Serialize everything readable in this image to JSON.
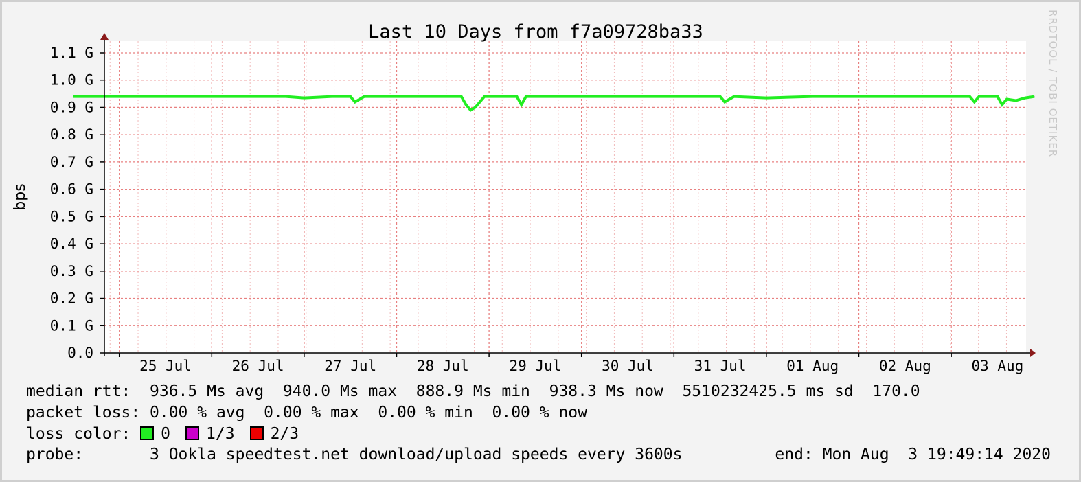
{
  "chart_data": {
    "type": "line",
    "title": "Last 10 Days from f7a09728ba33",
    "ylabel": "bps",
    "xlabel": "",
    "ylim": [
      0,
      1.1
    ],
    "y_unit": "G",
    "yticks": [
      "0.0",
      "0.1 G",
      "0.2 G",
      "0.3 G",
      "0.4 G",
      "0.5 G",
      "0.6 G",
      "0.7 G",
      "0.8 G",
      "0.9 G",
      "1.0 G",
      "1.1 G"
    ],
    "xticks": [
      "25 Jul",
      "26 Jul",
      "27 Jul",
      "28 Jul",
      "29 Jul",
      "30 Jul",
      "31 Jul",
      "01 Aug",
      "02 Aug",
      "03 Aug"
    ],
    "grid": true,
    "series": [
      {
        "name": "median rtt",
        "color": "#22ee22",
        "x": [
          24.0,
          25.0,
          26.0,
          26.3,
          26.5,
          26.8,
          27.0,
          27.05,
          27.15,
          27.5,
          28.0,
          28.2,
          28.25,
          28.3,
          28.35,
          28.45,
          28.8,
          28.85,
          28.9,
          29.0,
          29.5,
          30.0,
          30.5,
          31.0,
          31.05,
          31.15,
          31.5,
          32.0,
          32.5,
          33.0,
          33.5,
          33.7,
          33.75,
          33.8,
          34.0,
          34.05,
          34.1,
          34.2,
          34.3,
          34.4
        ],
        "y": [
          0.94,
          0.94,
          0.94,
          0.94,
          0.935,
          0.94,
          0.94,
          0.92,
          0.94,
          0.94,
          0.94,
          0.94,
          0.91,
          0.89,
          0.9,
          0.94,
          0.94,
          0.91,
          0.94,
          0.94,
          0.94,
          0.94,
          0.94,
          0.94,
          0.92,
          0.94,
          0.935,
          0.94,
          0.94,
          0.94,
          0.94,
          0.94,
          0.92,
          0.94,
          0.94,
          0.91,
          0.93,
          0.925,
          0.935,
          0.94
        ]
      }
    ]
  },
  "legend": {
    "rtt": "median rtt:  936.5 Ms avg  940.0 Ms max  888.9 Ms min  938.3 Ms now  5510232425.5 ms sd  170.0",
    "loss": "packet loss: 0.00 % avg  0.00 % max  0.00 % min  0.00 % now",
    "loss_color_label": "loss color: ",
    "loss_colors": [
      {
        "label": "0",
        "color": "#22ee22"
      },
      {
        "label": "1/3",
        "color": "#cc00cc"
      },
      {
        "label": "2/3",
        "color": "#ee0000"
      }
    ],
    "probe": "probe:       3 Ookla speedtest.net download/upload speeds every 3600s",
    "end": "end: Mon Aug  3 19:49:14 2020"
  },
  "credit": "RRDTOOL / TOBI OETIKER"
}
